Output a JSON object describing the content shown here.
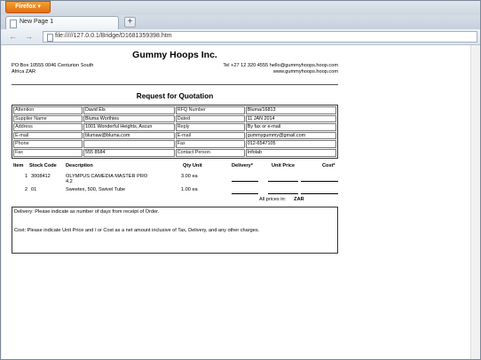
{
  "browser": {
    "app_button": "Firefox",
    "tab_title": "New Page 1",
    "new_tab": "+",
    "back": "←",
    "forward": "→",
    "url": "file://///127.0.0.1/Bridge/D1681359398.htm"
  },
  "document": {
    "company": "Gummy Hoops Inc.",
    "address_left": [
      "PO Box 10555 0046 Centurion South",
      "Africa ZAR"
    ],
    "address_right": [
      "Tel +27 12 320 4555 hello@gummyhoops.hoop.com",
      "www.gummyhoops.hoop.com"
    ],
    "title": "Request for Quotation",
    "info_rows": [
      [
        "Attention",
        "David Els",
        "RFQ Number",
        "Bluma/16813"
      ],
      [
        "Supplier Name",
        "Bluma Worthies",
        "Dated",
        "11 JAN 2014"
      ],
      [
        "Address",
        "1001 Wonderful Heights, Ascun",
        "Reply",
        "By fax or e-mail"
      ],
      [
        "E-mail",
        "blumaw@bluma.com",
        "E-mail",
        "gummygummy@gmail.com"
      ],
      [
        "Phone",
        "",
        "Fax",
        "012-6547105"
      ],
      [
        "Fax",
        "555 8584",
        "Contact Person",
        "Infolab"
      ]
    ],
    "item_headers": {
      "item": "Item",
      "stock_code": "Stock Code",
      "description": "Description",
      "qty": "Qty Unit",
      "delivery": "Delivery*",
      "unit_price": "Unit Price",
      "cost": "Cost*"
    },
    "items": [
      {
        "item": "1",
        "stock_code": "3008412",
        "description_1": "OLYMPUS CAMEDIA MASTER PRO",
        "description_2": "4.2",
        "qty": "3.00 ea"
      },
      {
        "item": "2",
        "stock_code": "01",
        "description_1": "Sweetex, 500, Swivel Tube",
        "description_2": "",
        "qty": "1.00 ea"
      }
    ],
    "prices_label": "All prices in:",
    "currency": "ZAR",
    "note_delivery": "Delivery: Please indicate as number of days from receipt of Order.",
    "note_cost": "Cost: Please indicate Unit Price and / or Cost as a net amount inclusive of Tax, Delivery, and any other charges."
  }
}
